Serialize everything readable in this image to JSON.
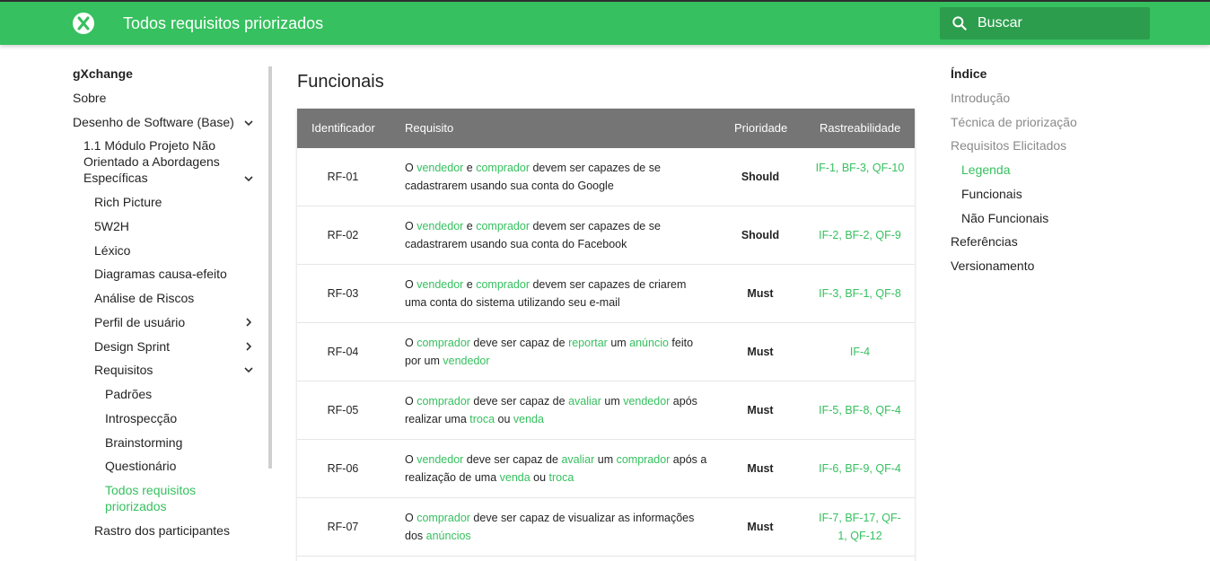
{
  "header": {
    "logo_icon": "exchange-x-icon",
    "title": "Todos requisitos priorizados",
    "search_placeholder": "Buscar",
    "search_icon": "search-icon",
    "accent_color": "#36c05f"
  },
  "nav": {
    "site": "gXchange",
    "sobre": "Sobre",
    "desenho": "Desenho de Software (Base)",
    "modulo": "1.1 Módulo Projeto Não Orientado a Abordagens Específicas",
    "rich_picture": "Rich Picture",
    "w2h": "5W2H",
    "lexico": "Léxico",
    "diagramas": "Diagramas causa-efeito",
    "analise": "Análise de Riscos",
    "perfil": "Perfil de usuário",
    "design_sprint": "Design Sprint",
    "requisitos": "Requisitos",
    "padroes": "Padrões",
    "introspeccao": "Introspecção",
    "brainstorming": "Brainstorming",
    "questionario": "Questionário",
    "todos": "Todos requisitos priorizados",
    "rastro": "Rastro dos participantes"
  },
  "main": {
    "section_title": "Funcionais",
    "columns": [
      "Identificador",
      "Requisito",
      "Prioridade",
      "Rastreabilidade"
    ],
    "rows": [
      {
        "id": "RF-01",
        "req": [
          [
            "O ",
            false
          ],
          [
            "vendedor",
            true
          ],
          [
            " e ",
            false
          ],
          [
            "comprador",
            true
          ],
          [
            " devem ser capazes de se cadastrarem usando sua conta do Google",
            false
          ]
        ],
        "priority": "Should",
        "trace": "IF-1, BF-3, QF-10"
      },
      {
        "id": "RF-02",
        "req": [
          [
            "O ",
            false
          ],
          [
            "vendedor",
            true
          ],
          [
            " e ",
            false
          ],
          [
            "comprador",
            true
          ],
          [
            " devem ser capazes de se cadastrarem usando sua conta do Facebook",
            false
          ]
        ],
        "priority": "Should",
        "trace": "IF-2, BF-2, QF-9"
      },
      {
        "id": "RF-03",
        "req": [
          [
            "O ",
            false
          ],
          [
            "vendedor",
            true
          ],
          [
            " e ",
            false
          ],
          [
            "comprador",
            true
          ],
          [
            " devem ser capazes de criarem uma conta do sistema utilizando seu e-mail",
            false
          ]
        ],
        "priority": "Must",
        "trace": "IF-3, BF-1, QF-8"
      },
      {
        "id": "RF-04",
        "req": [
          [
            "O ",
            false
          ],
          [
            "comprador",
            true
          ],
          [
            " deve ser capaz de ",
            false
          ],
          [
            "reportar",
            true
          ],
          [
            " um ",
            false
          ],
          [
            "anúncio",
            true
          ],
          [
            " feito por um ",
            false
          ],
          [
            "vendedor",
            true
          ]
        ],
        "priority": "Must",
        "trace": "IF-4"
      },
      {
        "id": "RF-05",
        "req": [
          [
            "O ",
            false
          ],
          [
            "comprador",
            true
          ],
          [
            " deve ser capaz de ",
            false
          ],
          [
            "avaliar",
            true
          ],
          [
            " um ",
            false
          ],
          [
            "vendedor",
            true
          ],
          [
            " após realizar uma ",
            false
          ],
          [
            "troca",
            true
          ],
          [
            " ou ",
            false
          ],
          [
            "venda",
            true
          ]
        ],
        "priority": "Must",
        "trace": "IF-5, BF-8, QF-4"
      },
      {
        "id": "RF-06",
        "req": [
          [
            "O ",
            false
          ],
          [
            "vendedor",
            true
          ],
          [
            " deve ser capaz de ",
            false
          ],
          [
            "avaliar",
            true
          ],
          [
            " um ",
            false
          ],
          [
            "comprador",
            true
          ],
          [
            " após a realização de uma ",
            false
          ],
          [
            "venda",
            true
          ],
          [
            " ou ",
            false
          ],
          [
            "troca",
            true
          ]
        ],
        "priority": "Must",
        "trace": "IF-6, BF-9, QF-4"
      },
      {
        "id": "RF-07",
        "req": [
          [
            "O ",
            false
          ],
          [
            "comprador",
            true
          ],
          [
            " deve ser capaz de visualizar as informações dos ",
            false
          ],
          [
            "anúncios",
            true
          ]
        ],
        "priority": "Must",
        "trace": "IF-7, BF-17, QF-1, QF-12"
      }
    ]
  },
  "toc": {
    "title": "Índice",
    "introducao": "Introdução",
    "tecnica": "Técnica de priorização",
    "elicitados": "Requisitos Elicitados",
    "legenda": "Legenda",
    "funcionais": "Funcionais",
    "nao_funcionais": "Não Funcionais",
    "referencias": "Referências",
    "versionamento": "Versionamento"
  }
}
